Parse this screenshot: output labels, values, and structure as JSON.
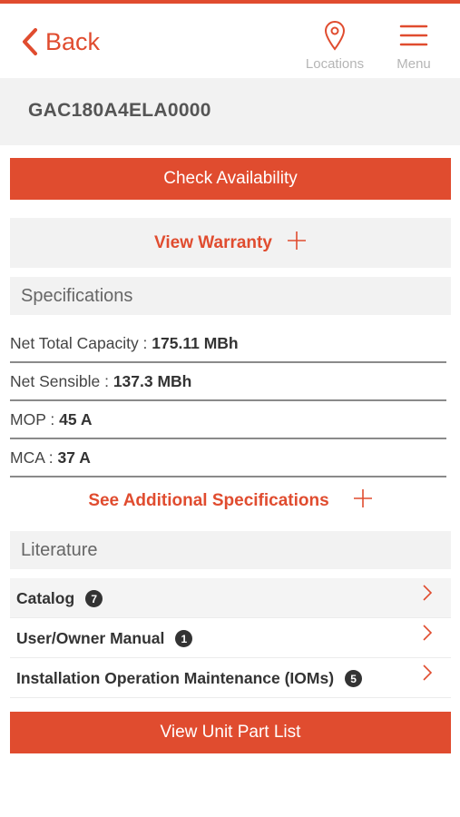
{
  "header": {
    "back_label": "Back",
    "locations_label": "Locations",
    "menu_label": "Menu"
  },
  "product": {
    "model_number": "GAC180A4ELA0000"
  },
  "actions": {
    "check_availability": "Check Availability",
    "view_warranty": "View Warranty",
    "see_additional": "See Additional Specifications",
    "view_parts": "View Unit Part List"
  },
  "specifications": {
    "title": "Specifications",
    "items": [
      {
        "label": "Net Total Capacity : ",
        "value": "175.11 MBh"
      },
      {
        "label": "Net Sensible : ",
        "value": "137.3 MBh"
      },
      {
        "label": "MOP : ",
        "value": "45 A"
      },
      {
        "label": "MCA : ",
        "value": "37 A"
      }
    ]
  },
  "literature": {
    "title": "Literature",
    "items": [
      {
        "label": "Catalog",
        "count": "7"
      },
      {
        "label": "User/Owner Manual",
        "count": "1"
      },
      {
        "label": "Installation Operation Maintenance (IOMs)",
        "count": "5"
      }
    ]
  },
  "colors": {
    "accent": "#e04c2f",
    "panel": "#f2f2f2",
    "muted": "#b5b5b5"
  }
}
